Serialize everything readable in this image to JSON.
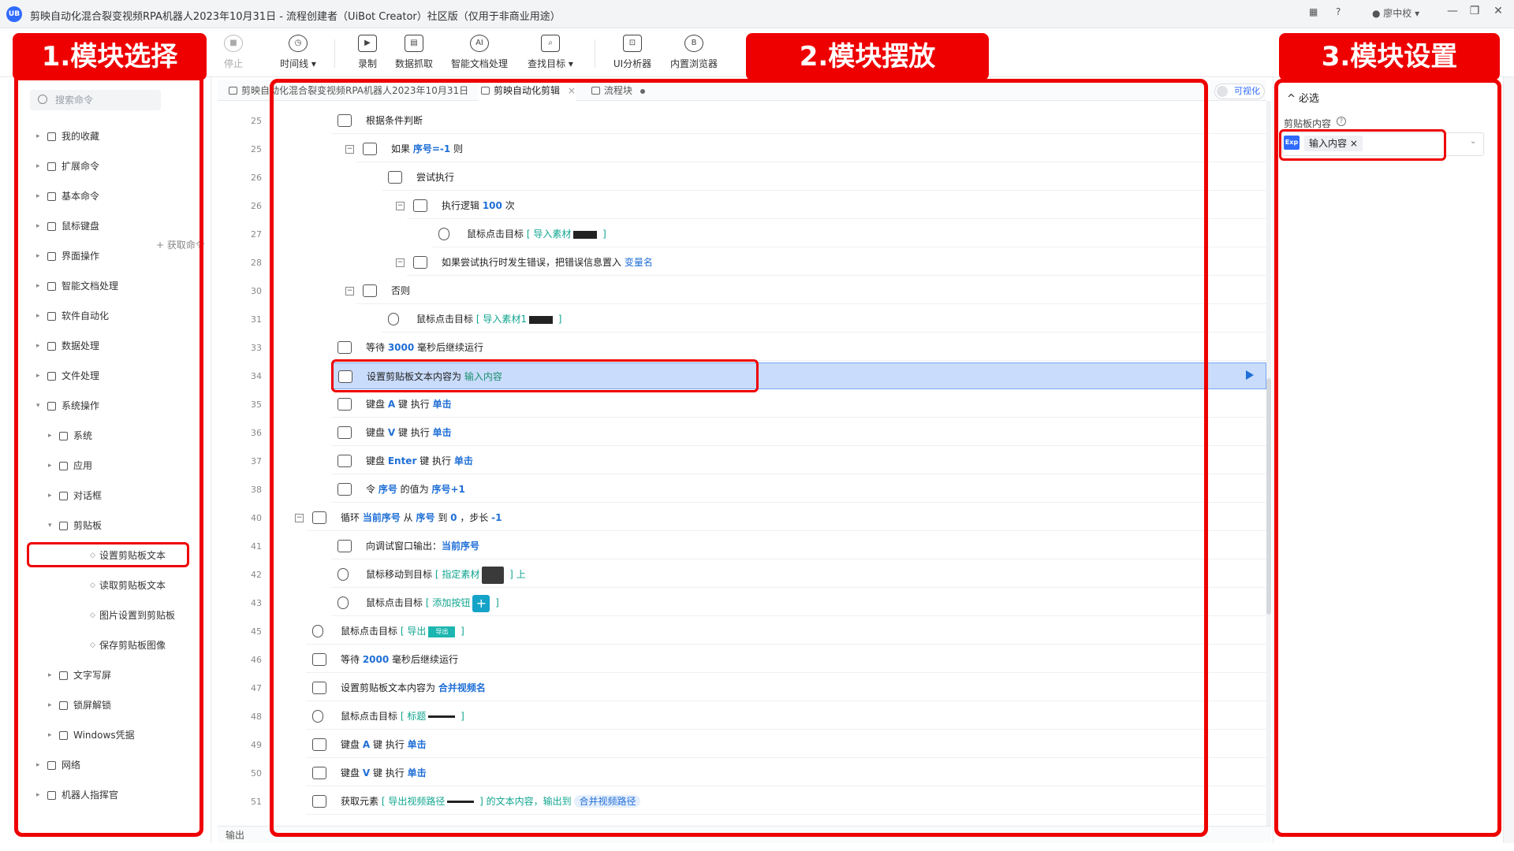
{
  "window": {
    "logo": "UB",
    "title": "剪映自动化混合裂变视频RPA机器人2023年10月31日 - 流程创建者（UiBot Creator）社区版（仅用于非商业用途）",
    "user": "廖中校",
    "help": "?",
    "min": "—",
    "restore": "❐",
    "close": "✕"
  },
  "toolbar": {
    "stop": "停止",
    "timeline": "时间线 ▾",
    "record": "录制",
    "data_scrape": "数据抓取",
    "smart_doc": "智能文档处理",
    "find_target": "查找目标 ▾",
    "ui_analyzer": "UI分析器",
    "browser": "内置浏览器"
  },
  "annotations": {
    "b1": "1.模块选择",
    "b2": "2.模块摆放",
    "b3": "3.模块设置"
  },
  "sidebar": {
    "search_placeholder": "搜索命令",
    "get_cmd": "+ 获取命令",
    "items": [
      "我的收藏",
      "扩展命令",
      "基本命令",
      "鼠标键盘",
      "界面操作",
      "智能文档处理",
      "软件自动化",
      "数据处理",
      "文件处理",
      "系统操作",
      "系统",
      "应用",
      "对话框",
      "剪贴板",
      "设置剪贴板文本",
      "读取剪贴板文本",
      "图片设置到剪贴板",
      "保存剪贴板图像",
      "文字写屏",
      "锁屏解锁",
      "Windows凭据",
      "网络",
      "机器人指挥官"
    ]
  },
  "tabs": {
    "t1": "剪映自动化混合裂变视频RPA机器人2023年10月31日",
    "t2": "剪映自动化剪辑",
    "t2_close": "×",
    "t3": "流程块",
    "toggle": "可视化"
  },
  "lines": [
    "25",
    "25",
    "26",
    "26",
    "27",
    "28",
    "30",
    "31",
    "33",
    "34",
    "35",
    "36",
    "37",
    "38",
    "40",
    "41",
    "42",
    "43",
    "45",
    "46",
    "47",
    "48",
    "49",
    "50",
    "51"
  ],
  "code": {
    "r0": "根据条件判断",
    "r1a": "如果 ",
    "r1b": "序号=-1",
    "r1c": " 则",
    "r2": "尝试执行",
    "r3a": "执行逻辑 ",
    "r3b": "100",
    "r3c": " 次",
    "r4a": "鼠标点击目标 ",
    "r4b": "[ 导入素材",
    "r4c": " ]",
    "r5a": "如果尝试执行时发生错误，把错误信息置入 ",
    "r5b": "变量名",
    "r6": "否则",
    "r7a": "鼠标点击目标 ",
    "r7b": "[ 导入素材1",
    "r7c": " ]",
    "r8a": "等待 ",
    "r8b": "3000",
    "r8c": " 毫秒后继续运行",
    "r9a": "设置剪贴板文本内容为 ",
    "r9b": "输入内容",
    "r10a": "键盘 ",
    "r10b": "A",
    "r10c": " 键 执行 ",
    "r10d": "单击",
    "r11a": "键盘 ",
    "r11b": "V",
    "r11c": " 键 执行 ",
    "r11d": "单击",
    "r12a": "键盘 ",
    "r12b": "Enter",
    "r12c": " 键 执行 ",
    "r12d": "单击",
    "r13a": "令 ",
    "r13b": "序号",
    "r13c": " 的值为 ",
    "r13d": "序号+1",
    "r14a": "循环 ",
    "r14b": "当前序号",
    "r14c": " 从 ",
    "r14d": "序号",
    "r14e": " 到 ",
    "r14f": "0",
    "r14g": " ，步长 ",
    "r14h": "-1",
    "r15a": "向调试窗口输出：",
    "r15b": "当前序号",
    "r16a": "鼠标移动到目标 ",
    "r16b": "[ 指定素材",
    "r16c": " ] 上",
    "r17a": "鼠标点击目标 ",
    "r17b": "[ 添加按钮",
    "r17c": " ]",
    "r18a": "鼠标点击目标 ",
    "r18b": "[ 导出",
    "r18c": " ]",
    "r18t": "导出",
    "r19a": "等待 ",
    "r19b": "2000",
    "r19c": " 毫秒后继续运行",
    "r20a": "设置剪贴板文本内容为 ",
    "r20b": "合并视频名",
    "r21a": "鼠标点击目标 ",
    "r21b": "[ 标题",
    "r21c": " ]",
    "r22a": "键盘 ",
    "r22b": "A",
    "r22c": " 键 执行 ",
    "r22d": "单击",
    "r23a": "键盘 ",
    "r23b": "V",
    "r23c": " 键 执行 ",
    "r23d": "单击",
    "r24a": "获取元素 ",
    "r24b": "[ 导出视频路径",
    "r24c": " ] 的文本内容，输出到 ",
    "r24d": "合并视频路径"
  },
  "output": "输出",
  "props": {
    "section": "^ 必选",
    "field": "剪贴板内容",
    "help": "?",
    "badge": "Exp",
    "value": "输入内容",
    "value_close": "×",
    "dropdown": "⌄"
  }
}
